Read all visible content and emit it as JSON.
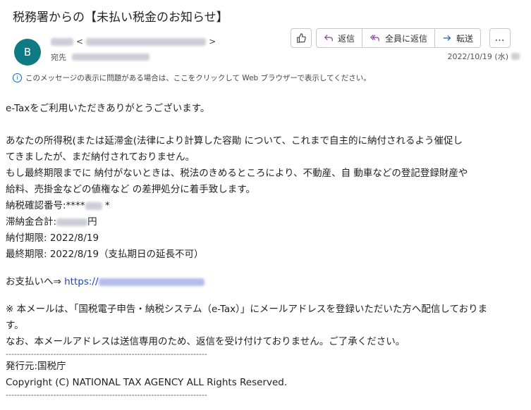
{
  "email": {
    "subject": "税務署からの【未払い税金のお知らせ】",
    "avatar_initial": "B",
    "sender_open": "<",
    "sender_close": ">",
    "to_label": "宛先",
    "date": "2022/10/19 (水)",
    "actions": {
      "reply": "返信",
      "reply_all": "全員に返信",
      "forward": "転送",
      "more": "…"
    },
    "notice": "このメッセージの表示に問題がある場合は、ここをクリックして Web ブラウザーで表示してください。",
    "body": {
      "greeting": "e-Taxをご利用いただきありがとうございます。",
      "para1_line1": "あなたの所得税(または延滞金(法律により計算した容勛 について、これまで自主的に納付されるよう催促し",
      "para1_line2": "てきましたが、まだ納付されておりません。",
      "para1_line3": "もし最終期限までに 納付がないときは、税法のきめるところにより、不動産、自 動車などの登記登録財産や",
      "para1_line4": "給料、売掛金などの値権など の差押処分に着手致します。",
      "confirm_label": "納税確認番号:****",
      "amount_label": "滞納金合計:",
      "amount_unit": "円",
      "due": "納付期限: 2022/8/19",
      "final_due": "最終期限: 2022/8/19（支払期日の延長不可）",
      "pay_prefix": "お支払いへ⇒ ",
      "link_prefix": "https://",
      "note_line1": "※ 本メールは、「国税電子申告・納税システム（e-Tax）」にメールアドレスを登録いただいた方へ配信しておりま",
      "note_line2": "す。",
      "note_line3": "なお、本メールアドレスは送信専用のため、返信を受け付けておりません。ご了承ください。",
      "rule": "------------------------------------------------------------------------",
      "from_line": "発行元:国税庁",
      "copyright": "Copyright (C) NATIONAL TAX AGENCY ALL Rights Reserved.",
      "rule2": "------------------------------------------------------------------------"
    }
  }
}
